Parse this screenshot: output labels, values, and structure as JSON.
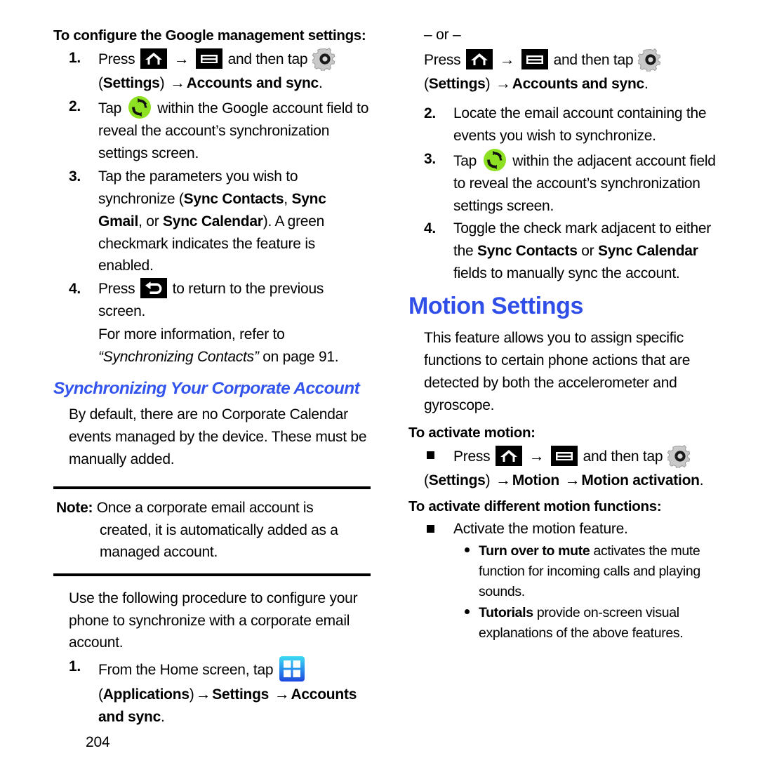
{
  "document": {
    "page_number": "204",
    "accent_blue": "#3355ee",
    "heading_blue": "#2f4fe8",
    "sync_icon_green": "#8ee022",
    "apps_icon_gradient_from": "#34d7f0",
    "apps_icon_gradient_to": "#1f52e0"
  },
  "left_column": {
    "task_heading": "To configure the Google management settings:",
    "steps": [
      {
        "num": "1.",
        "pre": "Press",
        "icon_home": "home-icon",
        "arrow": "→",
        "icon_menu": "menu-icon",
        "mid": "and then tap",
        "icon_gear": "gear-icon",
        "line2_paren_open": "(",
        "line2_bold_1": "Settings",
        "line2_paren_close": ")",
        "line2_arrow": "→",
        "line2_bold_2": "Accounts and sync",
        "line2_period": "."
      },
      {
        "num": "2.",
        "pre": "Tap",
        "icon_sync": "sync-icon",
        "rest": "within the Google account field to reveal the account’s synchronization settings screen."
      },
      {
        "num": "3.",
        "t1": "Tap the parameters you wish to synchronize (",
        "b1": "Sync Contacts",
        "t2": ", ",
        "b2": "Sync Gmail",
        "t3": ", or ",
        "b3": "Sync Calendar",
        "t4": "). A green checkmark indicates the feature is enabled."
      },
      {
        "num": "4.",
        "pre": "Press",
        "icon_back": "back-icon",
        "rest": "to return to the previous screen."
      }
    ],
    "more_info_line1": "For more information, refer to",
    "more_info_ref": "“Synchronizing Contacts”",
    "more_info_tail": " on page 91.",
    "blue_heading": "Synchronizing Your Corporate Account",
    "intro_paragraph": "By default, there are no Corporate Calendar events managed by the device. These must be manually added.",
    "note": {
      "label": "Note:",
      "text": " Once a corporate email account is created, it is automatically added as a managed account."
    },
    "procedure_paragraph": "Use the following procedure to configure your phone to synchronize with a corporate email account.",
    "procedure_step": {
      "num": "1.",
      "pre": "From the Home screen, tap",
      "icon_apps": "applications-icon",
      "line2_paren_open": "(",
      "line2_bold_1": "Applications",
      "line2_paren_close": ")",
      "line2_arrow_1": "→",
      "line2_bold_2": "Settings",
      "line2_arrow_2": "→",
      "line2_bold_3": "Accounts and sync",
      "line2_period": "."
    }
  },
  "right_column": {
    "or_divider": "– or –",
    "or_step": {
      "pre": "Press",
      "icon_home": "home-icon",
      "arrow": "→",
      "icon_menu": "menu-icon",
      "mid": "and then tap",
      "icon_gear": "gear-icon",
      "line2_paren_open": "(",
      "line2_bold_1": "Settings",
      "line2_paren_close": ")",
      "line2_arrow": "→",
      "line2_bold_2": "Accounts and sync",
      "line2_period": "."
    },
    "steps": [
      {
        "num": "2.",
        "text": "Locate the email account containing the events you wish to synchronize."
      },
      {
        "num": "3.",
        "pre": "Tap",
        "icon_sync": "sync-icon",
        "rest": "within the adjacent account field to reveal the account’s synchronization settings screen."
      },
      {
        "num": "4.",
        "t1": "Toggle the check mark adjacent to either the ",
        "b1": "Sync Contacts",
        "t2": " or ",
        "b2": "Sync Calendar",
        "t3": " fields to manually sync the account."
      }
    ],
    "motion_heading": "Motion Settings",
    "motion_paragraph": "This feature allows you to assign specific functions to certain phone actions that are detected by both the accelerometer and gyroscope.",
    "activate_motion_heading": "To activate motion:",
    "activate_motion_bullet": {
      "pre": "Press",
      "icon_home": "home-icon",
      "arrow": "→",
      "icon_menu": "menu-icon",
      "mid": "and then tap",
      "icon_gear": "gear-icon",
      "line2_paren_open": "(",
      "line2_bold_1": "Settings",
      "line2_paren_close": ")",
      "line2_arrow_1": "→",
      "line2_bold_2": "Motion",
      "line2_arrow_2": "→",
      "line2_bold_3": "Motion activation",
      "line2_period": "."
    },
    "different_functions_heading": "To activate different motion functions:",
    "activate_feature_bullet": "Activate the motion feature.",
    "sub_bullets": [
      {
        "bold": "Turn over to mute",
        "text": " activates the mute function for incoming calls and playing sounds."
      },
      {
        "bold": "Tutorials",
        "text": " provide on-screen visual explanations of the above features."
      }
    ]
  }
}
